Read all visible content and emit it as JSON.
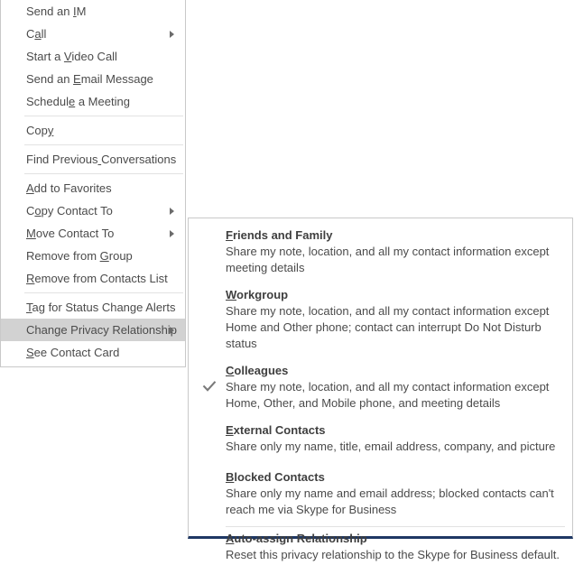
{
  "context_menu": {
    "items": [
      {
        "type": "item",
        "label": "Send an IM",
        "acc_index": 8,
        "submenu": false
      },
      {
        "type": "item",
        "label": "Call",
        "acc_index": 1,
        "submenu": true
      },
      {
        "type": "item",
        "label": "Start a Video Call",
        "acc_index": 8,
        "submenu": false
      },
      {
        "type": "item",
        "label": "Send an Email Message",
        "acc_index": 8,
        "submenu": false
      },
      {
        "type": "item",
        "label": "Schedule a Meeting",
        "acc_index": 7,
        "submenu": false
      },
      {
        "type": "separator"
      },
      {
        "type": "item",
        "label": "Copy",
        "acc_index": 3,
        "submenu": false
      },
      {
        "type": "separator"
      },
      {
        "type": "item",
        "label": "Find Previous Conversations",
        "acc_index": 13,
        "submenu": false
      },
      {
        "type": "separator"
      },
      {
        "type": "item",
        "label": "Add to Favorites",
        "acc_index": 0,
        "submenu": false
      },
      {
        "type": "item",
        "label": "Copy Contact To",
        "acc_index": 1,
        "submenu": true
      },
      {
        "type": "item",
        "label": "Move Contact To",
        "acc_index": 0,
        "submenu": true
      },
      {
        "type": "item",
        "label": "Remove from Group",
        "acc_index": 12,
        "submenu": false
      },
      {
        "type": "item",
        "label": "Remove from Contacts List",
        "acc_index": 0,
        "submenu": false
      },
      {
        "type": "separator"
      },
      {
        "type": "item",
        "label": "Tag for Status Change Alerts",
        "acc_index": 0,
        "submenu": false
      },
      {
        "type": "item",
        "label": "Change Privacy Relationship",
        "acc_index": 4,
        "submenu": true,
        "highlighted": true
      },
      {
        "type": "item",
        "label": "See Contact Card",
        "acc_index": 0,
        "submenu": false
      }
    ]
  },
  "privacy_submenu": {
    "items": [
      {
        "type": "option",
        "title": "Friends and Family",
        "acc_index": 0,
        "description": "Share my note, location, and all my contact information except\nmeeting details",
        "checked": false
      },
      {
        "type": "option",
        "title": "Workgroup",
        "acc_index": 0,
        "description": "Share my note, location, and all my contact information except\nHome and Other phone; contact can interrupt Do Not Disturb status",
        "checked": false
      },
      {
        "type": "option",
        "title": "Colleagues",
        "acc_index": 0,
        "description": "Share my note, location, and all my contact information except\nHome, Other, and Mobile phone, and meeting details",
        "checked": true
      },
      {
        "type": "option",
        "title": "External Contacts",
        "acc_index": 0,
        "description": "Share only my name, title, email address, company, and picture",
        "checked": false
      },
      {
        "type": "option",
        "title": "Blocked Contacts",
        "acc_index": 0,
        "description": "Share only my name and email address; blocked contacts can't\nreach me via Skype for Business",
        "checked": false
      },
      {
        "type": "separator"
      },
      {
        "type": "option",
        "title": "Auto-assign Relationship",
        "acc_index": 0,
        "description": "Reset this privacy relationship to the Skype for Business default.",
        "checked": false
      }
    ],
    "check_glyph": "checkmark-icon"
  },
  "colors": {
    "menu_background": "#ffffff",
    "menu_border": "#c9c9c9",
    "highlight": "#d2d2d2",
    "text": "#4b4b4b",
    "title_text": "#3f3f3f",
    "separator": "#e2e2e2",
    "submenu_bottom_accent": "#1f3864",
    "check_color": "#7a7a7a"
  }
}
